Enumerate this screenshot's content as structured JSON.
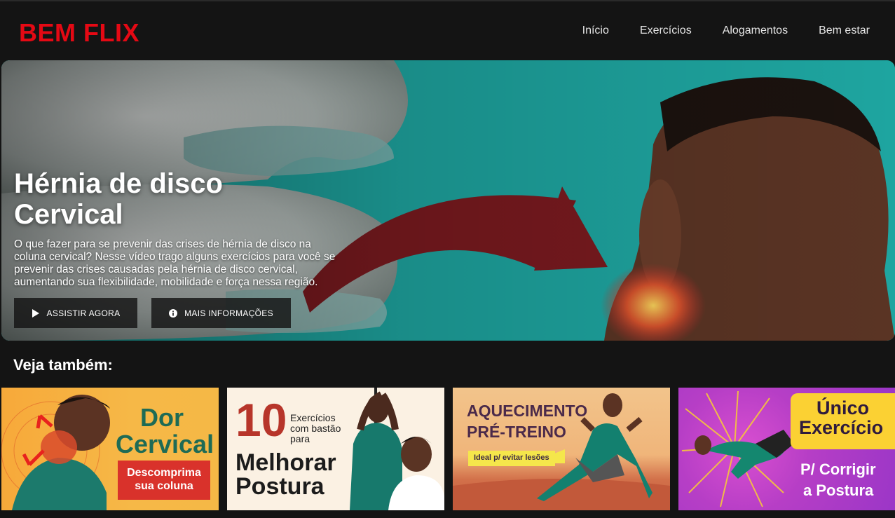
{
  "header": {
    "logo": "BEM FLIX",
    "nav": [
      "Início",
      "Exercícios",
      "Alogamentos",
      "Bem estar"
    ]
  },
  "hero": {
    "title": "Hérnia de disco Cervical",
    "description": "O que fazer para se prevenir das crises de hérnia de disco na coluna cervical? Nesse vídeo trago alguns exercícios para você se prevenir das crises causadas pela hérnia de disco cervical, aumentando sua flexibilidade, mobilidade e força nessa região.",
    "play_label": "ASSISTIR AGORA",
    "info_label": "MAIS INFORMAÇÕES"
  },
  "section": {
    "title": "Veja também:"
  },
  "cards": [
    {
      "line1": "Dor",
      "line2": "Cervical",
      "sub": "Descomprima sua coluna"
    },
    {
      "number": "10",
      "small": "Exercícios com bastão para",
      "big1": "Melhorar",
      "big2": "Postura"
    },
    {
      "line1": "AQUECIMENTO",
      "line2": "PRÉ-TREINO",
      "tag": "Ideal p/ evitar lesões"
    },
    {
      "line1": "Único",
      "line2": "Exercício",
      "line3": "P/ Corrigir",
      "line4": "a Postura"
    }
  ],
  "colors": {
    "brand": "#e50914",
    "background": "#141414",
    "hero_teal": "#1aa39e"
  }
}
